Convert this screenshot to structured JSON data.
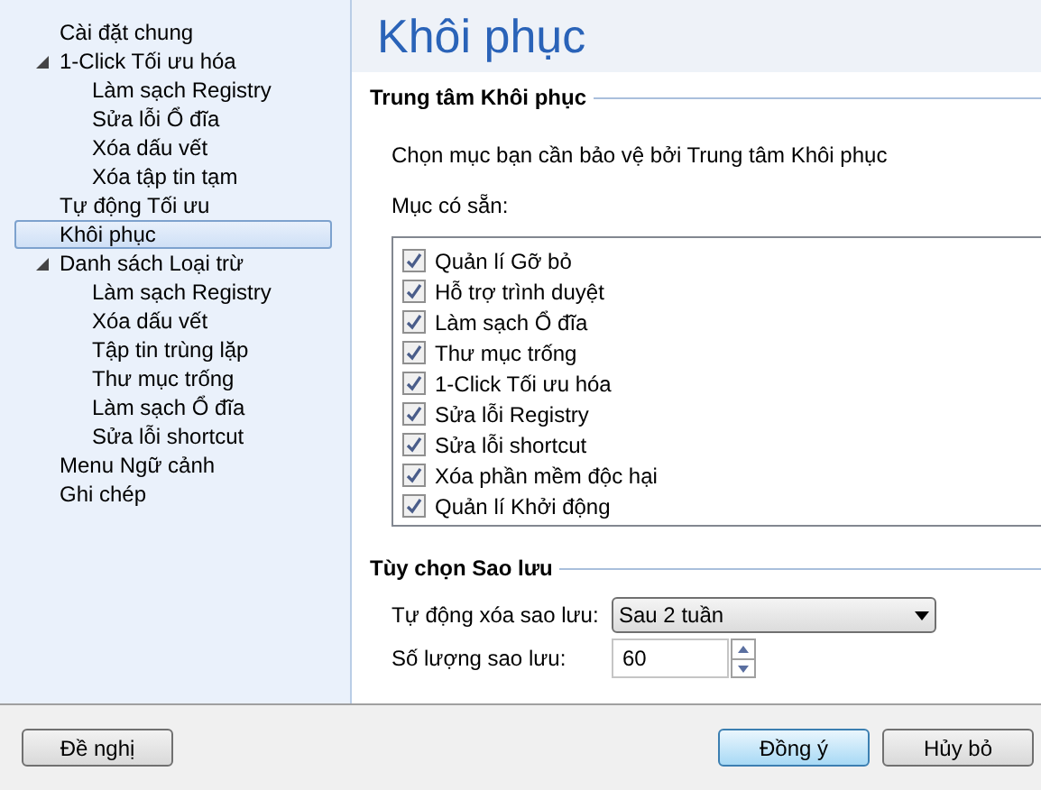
{
  "sidebar": {
    "items": [
      {
        "label": "Cài đặt chung",
        "selected": false
      },
      {
        "label": "1-Click Tối ưu hóa",
        "selected": false,
        "expanded": true,
        "children": [
          {
            "label": "Làm sạch Registry",
            "selected": false
          },
          {
            "label": "Sửa lỗi Ổ đĩa",
            "selected": false
          },
          {
            "label": "Xóa dấu vết",
            "selected": false
          },
          {
            "label": "Xóa tập tin tạm",
            "selected": false
          }
        ]
      },
      {
        "label": "Tự động Tối ưu",
        "selected": false
      },
      {
        "label": "Khôi phục",
        "selected": true
      },
      {
        "label": "Danh sách Loại trừ",
        "selected": false,
        "expanded": true,
        "children": [
          {
            "label": "Làm sạch Registry",
            "selected": false
          },
          {
            "label": "Xóa dấu vết",
            "selected": false
          },
          {
            "label": "Tập tin trùng lặp",
            "selected": false
          },
          {
            "label": "Thư mục trống",
            "selected": false
          },
          {
            "label": "Làm sạch Ổ đĩa",
            "selected": false
          },
          {
            "label": "Sửa lỗi shortcut",
            "selected": false
          }
        ]
      },
      {
        "label": "Menu Ngữ cảnh",
        "selected": false
      },
      {
        "label": "Ghi chép",
        "selected": false
      }
    ]
  },
  "page": {
    "title": "Khôi phục"
  },
  "restore_center": {
    "heading": "Trung tâm Khôi phục",
    "description": "Chọn mục bạn cần bảo vệ bởi Trung tâm Khôi phục",
    "list_label": "Mục có sẵn:",
    "items": [
      {
        "label": "Quản lí Gỡ bỏ",
        "checked": true
      },
      {
        "label": "Hỗ trợ trình duyệt",
        "checked": true
      },
      {
        "label": "Làm sạch Ổ đĩa",
        "checked": true
      },
      {
        "label": "Thư mục trống",
        "checked": true
      },
      {
        "label": "1-Click Tối ưu hóa",
        "checked": true
      },
      {
        "label": "Sửa lỗi Registry",
        "checked": true
      },
      {
        "label": "Sửa lỗi shortcut",
        "checked": true
      },
      {
        "label": "Xóa phần mềm độc hại",
        "checked": true
      },
      {
        "label": "Quản lí Khởi động",
        "checked": true
      }
    ]
  },
  "backup_options": {
    "heading": "Tùy chọn Sao lưu",
    "auto_delete_label": "Tự động xóa sao lưu:",
    "auto_delete_value": "Sau 2 tuần",
    "count_label": "Số lượng sao lưu:",
    "count_value": "60"
  },
  "buttons": {
    "suggest": "Đề nghị",
    "ok": "Đồng ý",
    "cancel": "Hủy bỏ"
  }
}
